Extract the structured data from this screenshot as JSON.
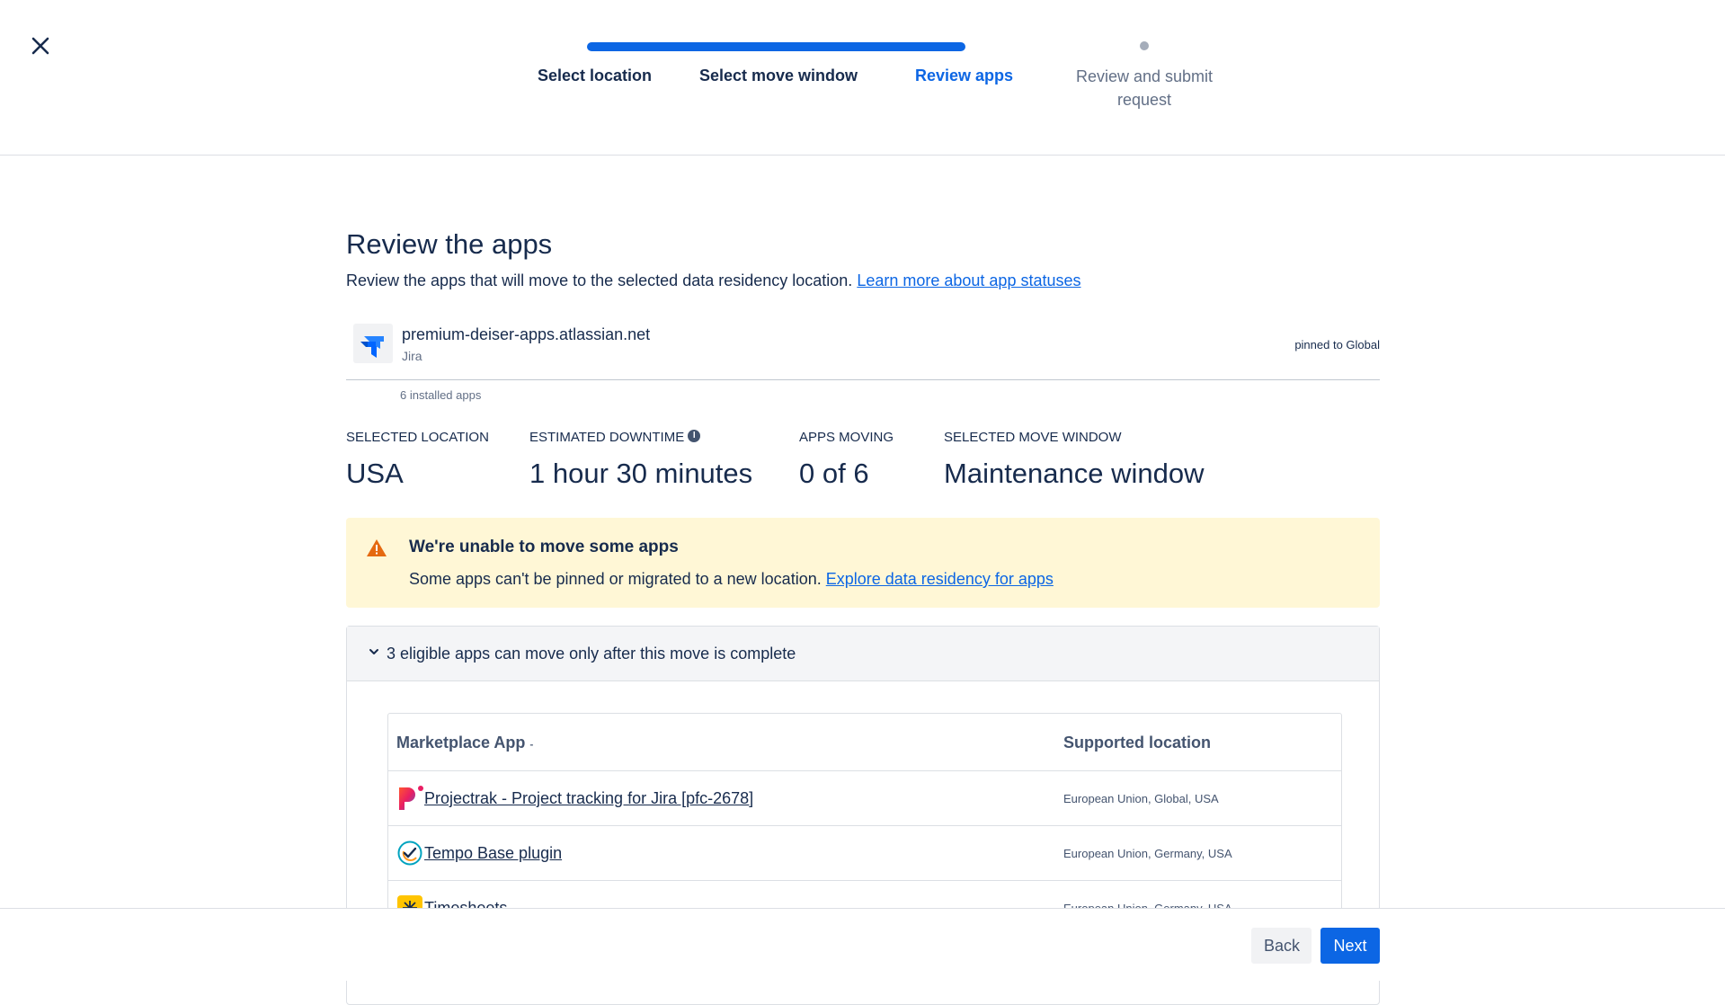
{
  "header": {
    "steps": [
      {
        "label": "Select location"
      },
      {
        "label": "Select move window"
      },
      {
        "label": "Review apps"
      },
      {
        "label": "Review and submit request"
      }
    ],
    "completed_fraction": 0.75,
    "current_step": 3
  },
  "main": {
    "title": "Review the apps",
    "description": "Review the apps that will move to the selected data residency location.",
    "learn_more_link": "Learn more about app statuses",
    "site": {
      "name": "premium-deiser-apps.atlassian.net",
      "product": "Jira",
      "pinned": "pinned to Global",
      "installed": "6 installed apps"
    },
    "stats": [
      {
        "label": "SELECTED LOCATION",
        "value": "USA"
      },
      {
        "label": "ESTIMATED DOWNTIME",
        "value": "1 hour 30 minutes"
      },
      {
        "label": "APPS MOVING",
        "value": "0 of 6"
      },
      {
        "label": "SELECTED MOVE WINDOW",
        "value": "Maintenance window"
      }
    ],
    "warning": {
      "title": "We're unable to move some apps",
      "text": "Some apps can't be pinned or migrated to a new location.",
      "link": "Explore data residency for apps"
    },
    "panel": {
      "title": "3 eligible apps can move only after this move is complete",
      "columns": [
        "Marketplace App",
        "Supported location"
      ],
      "rows": [
        {
          "app": "Projectrak - Project tracking for Jira [pfc-2678]",
          "location": "European Union, Global, USA",
          "icon": "projectrak-logo-icon"
        },
        {
          "app": "Tempo Base plugin",
          "location": "European Union, Germany, USA",
          "icon": "tempo-logo-icon"
        },
        {
          "app": "Timesheets",
          "location": "European Union, Germany, USA",
          "icon": "timesheets-logo-icon"
        }
      ]
    }
  },
  "footer": {
    "back_label": "Back",
    "next_label": "Next"
  },
  "colors": {
    "accent": "#0c66e4",
    "warning_bg": "#fff7d6",
    "warning_icon": "#e56910"
  }
}
